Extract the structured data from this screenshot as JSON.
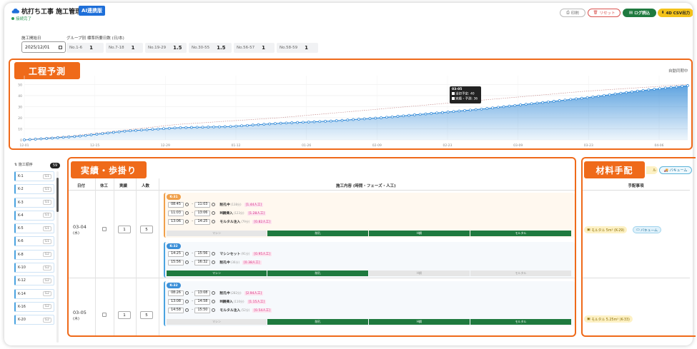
{
  "header": {
    "title": "杭打ち工事 施工管理",
    "ai_badge": "AI連携版",
    "status": "接続完了",
    "buttons": {
      "print": "印刷",
      "reset": "リセット",
      "log": "ログ読込",
      "csv": "4D CSV出力"
    }
  },
  "settings": {
    "start_label": "施工開始日",
    "start_date": "2025/12/01",
    "group_label": "グループ別 標準所要日数 (日/本)",
    "groups": [
      {
        "name": "No.1-6",
        "value": "1"
      },
      {
        "name": "No.7-18",
        "value": "1"
      },
      {
        "name": "No.19-29",
        "value": "1.5"
      },
      {
        "name": "No.30-55",
        "value": "1.5"
      },
      {
        "name": "No.56-57",
        "value": "1"
      },
      {
        "name": "No.58-59",
        "value": "1"
      }
    ]
  },
  "forecast": {
    "section_title": "工程予測",
    "auto_sync": "自動同期中",
    "tooltip": {
      "date": "03-05",
      "plan_label": "当初予定: 40",
      "actual_label": "実績・予測: 36"
    },
    "colors": {
      "actual": "#2b86d6",
      "plan": "#c88f8f"
    }
  },
  "chart_data": {
    "type": "area",
    "x_ticks": [
      "12-01",
      "12-15",
      "12-29",
      "01-12",
      "01-26",
      "02-09",
      "02-23",
      "03-09",
      "03-23",
      "04-06"
    ],
    "y_ticks": [
      0,
      10,
      20,
      30,
      40,
      50
    ],
    "ylim": [
      0,
      58
    ],
    "series": [
      {
        "name": "当初予定",
        "style": "dashed",
        "values": [
          0,
          4,
          9,
          14,
          17,
          20,
          24,
          28,
          32,
          36,
          40,
          44,
          47,
          50
        ]
      },
      {
        "name": "実績・予測",
        "style": "area",
        "values": [
          0,
          3,
          8,
          11,
          12,
          15,
          17,
          20,
          24,
          28,
          33,
          38,
          44,
          49
        ]
      }
    ]
  },
  "sidebar": {
    "header": "施工順序",
    "count": "59",
    "items": [
      {
        "label": "K-1",
        "tag": "G1"
      },
      {
        "label": "K-2",
        "tag": "G1"
      },
      {
        "label": "K-3",
        "tag": "G1"
      },
      {
        "label": "K-4",
        "tag": "G1"
      },
      {
        "label": "K-5",
        "tag": "G1"
      },
      {
        "label": "K-6",
        "tag": "G1"
      },
      {
        "label": "K-8",
        "tag": "G2"
      },
      {
        "label": "K-10",
        "tag": "G2"
      },
      {
        "label": "K-12",
        "tag": "G2"
      },
      {
        "label": "K-14",
        "tag": "G2"
      },
      {
        "label": "K-16",
        "tag": "G2"
      },
      {
        "label": "K-20",
        "tag": "G2"
      }
    ]
  },
  "progress": {
    "section_title": "実績・歩掛り",
    "columns": {
      "date": "日付",
      "rest": "休工",
      "actual": "実績",
      "people": "人数",
      "content": "施工内容 (時間・フェーズ・人工)"
    },
    "phases": [
      "マシン",
      "削孔",
      "H鋼",
      "モルタル"
    ],
    "rows": [
      {
        "date": "03-04",
        "weekday": "(水)",
        "actual": "1",
        "people": "5",
        "blocks": [
          {
            "pile": "K-31",
            "tasks": [
              {
                "start": "08:45",
                "end": "11:03",
                "name": "削孔中",
                "sub": "(138分)",
                "mh": "[1.44人工]"
              },
              {
                "start": "11:03",
                "end": "13:06",
                "name": "H鋼挿入",
                "sub": "(123分)",
                "mh": "[1.28人工]"
              },
              {
                "start": "13:06",
                "end": "14:25",
                "name": "モルタル注入",
                "sub": "(79分)",
                "mh": "[0.82人工]"
              }
            ],
            "active": [
              false,
              true,
              true,
              true
            ]
          },
          {
            "pile": "K-32",
            "tasks": [
              {
                "start": "14:25",
                "end": "15:56",
                "name": "マシンセット",
                "sub": "(91分)",
                "mh": "[0.95人工]"
              },
              {
                "start": "15:56",
                "end": "16:32",
                "name": "削孔中",
                "sub": "(36分)",
                "mh": "[0.38人工]"
              }
            ],
            "active": [
              true,
              true,
              false,
              false
            ]
          }
        ]
      },
      {
        "date": "03-05",
        "weekday": "(木)",
        "actual": "1",
        "people": "5",
        "blocks": [
          {
            "pile": "K-32",
            "tasks": [
              {
                "start": "08:26",
                "end": "13:08",
                "name": "削孔中",
                "sub": "(282分)",
                "mh": "[2.94人工]"
              },
              {
                "start": "13:08",
                "end": "14:58",
                "name": "H鋼挿入",
                "sub": "(110分)",
                "mh": "[1.15人工]"
              },
              {
                "start": "14:58",
                "end": "15:50",
                "name": "モルタル注入",
                "sub": "(52分)",
                "mh": "[0.54人工]"
              }
            ],
            "active": [
              false,
              true,
              true,
              true
            ]
          }
        ]
      }
    ]
  },
  "materials": {
    "section_title": "材料手配",
    "column": "手配事項",
    "vacuum_label": "バキューム",
    "row1_mortar": "モルタル 5m³ (K-29)",
    "row1_vacuum": "バキューム",
    "row2_mortar": "モルタル 5.25m³ (K-33)"
  }
}
